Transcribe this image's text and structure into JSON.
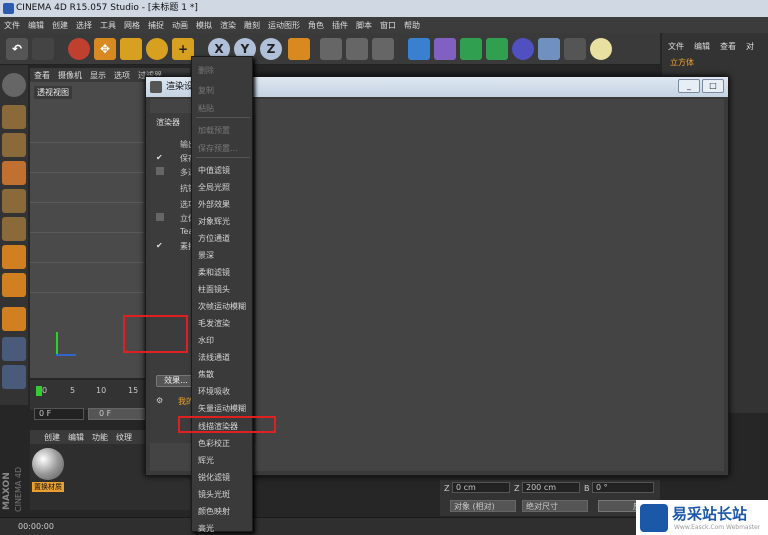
{
  "window": {
    "title": "CINEMA 4D R15.057 Studio - [未标题 1 *]"
  },
  "menubar": [
    "文件",
    "编辑",
    "创建",
    "选择",
    "工具",
    "网格",
    "捕捉",
    "动画",
    "模拟",
    "渲染",
    "雕刻",
    "运动图形",
    "角色",
    "插件",
    "脚本",
    "窗口",
    "帮助"
  ],
  "toolbar": {
    "x": "X",
    "y": "Y",
    "z": "Z"
  },
  "right_panel": {
    "menu": [
      "文件",
      "编辑",
      "查看",
      "对"
    ],
    "object": "立方体"
  },
  "viewport": {
    "menu": [
      "查看",
      "摄像机",
      "显示",
      "选项",
      "过滤器"
    ],
    "label": "透视视图"
  },
  "timeline": {
    "ticks": [
      "0",
      "5",
      "10",
      "15"
    ],
    "frame1": "0 F",
    "frame2": "0 F"
  },
  "material": {
    "menu": [
      "创建",
      "编辑",
      "功能",
      "纹理"
    ],
    "name": "置换材质"
  },
  "status": {
    "time": "00:00:00"
  },
  "coords": {
    "z_pos": "0 cm",
    "z_size": "200 cm",
    "b_rot": "0 °",
    "mode": "对象 (相对)",
    "size_mode": "绝对尺寸",
    "apply": "应用"
  },
  "dialog": {
    "title": "渲染设置",
    "renderer_label": "渲染器",
    "items": [
      "输出",
      "保存",
      "多通道",
      "抗锯齿",
      "选项",
      "立体",
      "Team",
      "素描"
    ],
    "effect_button": "效果...",
    "my_render": "我的"
  },
  "context_menu": {
    "group1": [
      "删除",
      "复制",
      "粘贴"
    ],
    "group2": [
      "加载预置",
      "保存预置..."
    ],
    "group3": [
      "中值滤镜",
      "全局光照",
      "外部效果",
      "对象辉光",
      "方位通道",
      "景深",
      "柔和滤镜",
      "柱面镜头",
      "次帧运动模糊",
      "毛发渲染",
      "水印",
      "法线通道",
      "焦散",
      "环境吸收",
      "矢量运动模糊",
      "线描渲染器",
      "色彩校正",
      "辉光",
      "锐化滤镜",
      "镜头光斑",
      "颜色映射",
      "高光"
    ]
  },
  "maxon": {
    "brand": "MAXON",
    "product": "CINEMA 4D"
  },
  "watermark": {
    "title": "易采站长站",
    "subtitle": "Www.Easck.Com  Webmaster"
  }
}
